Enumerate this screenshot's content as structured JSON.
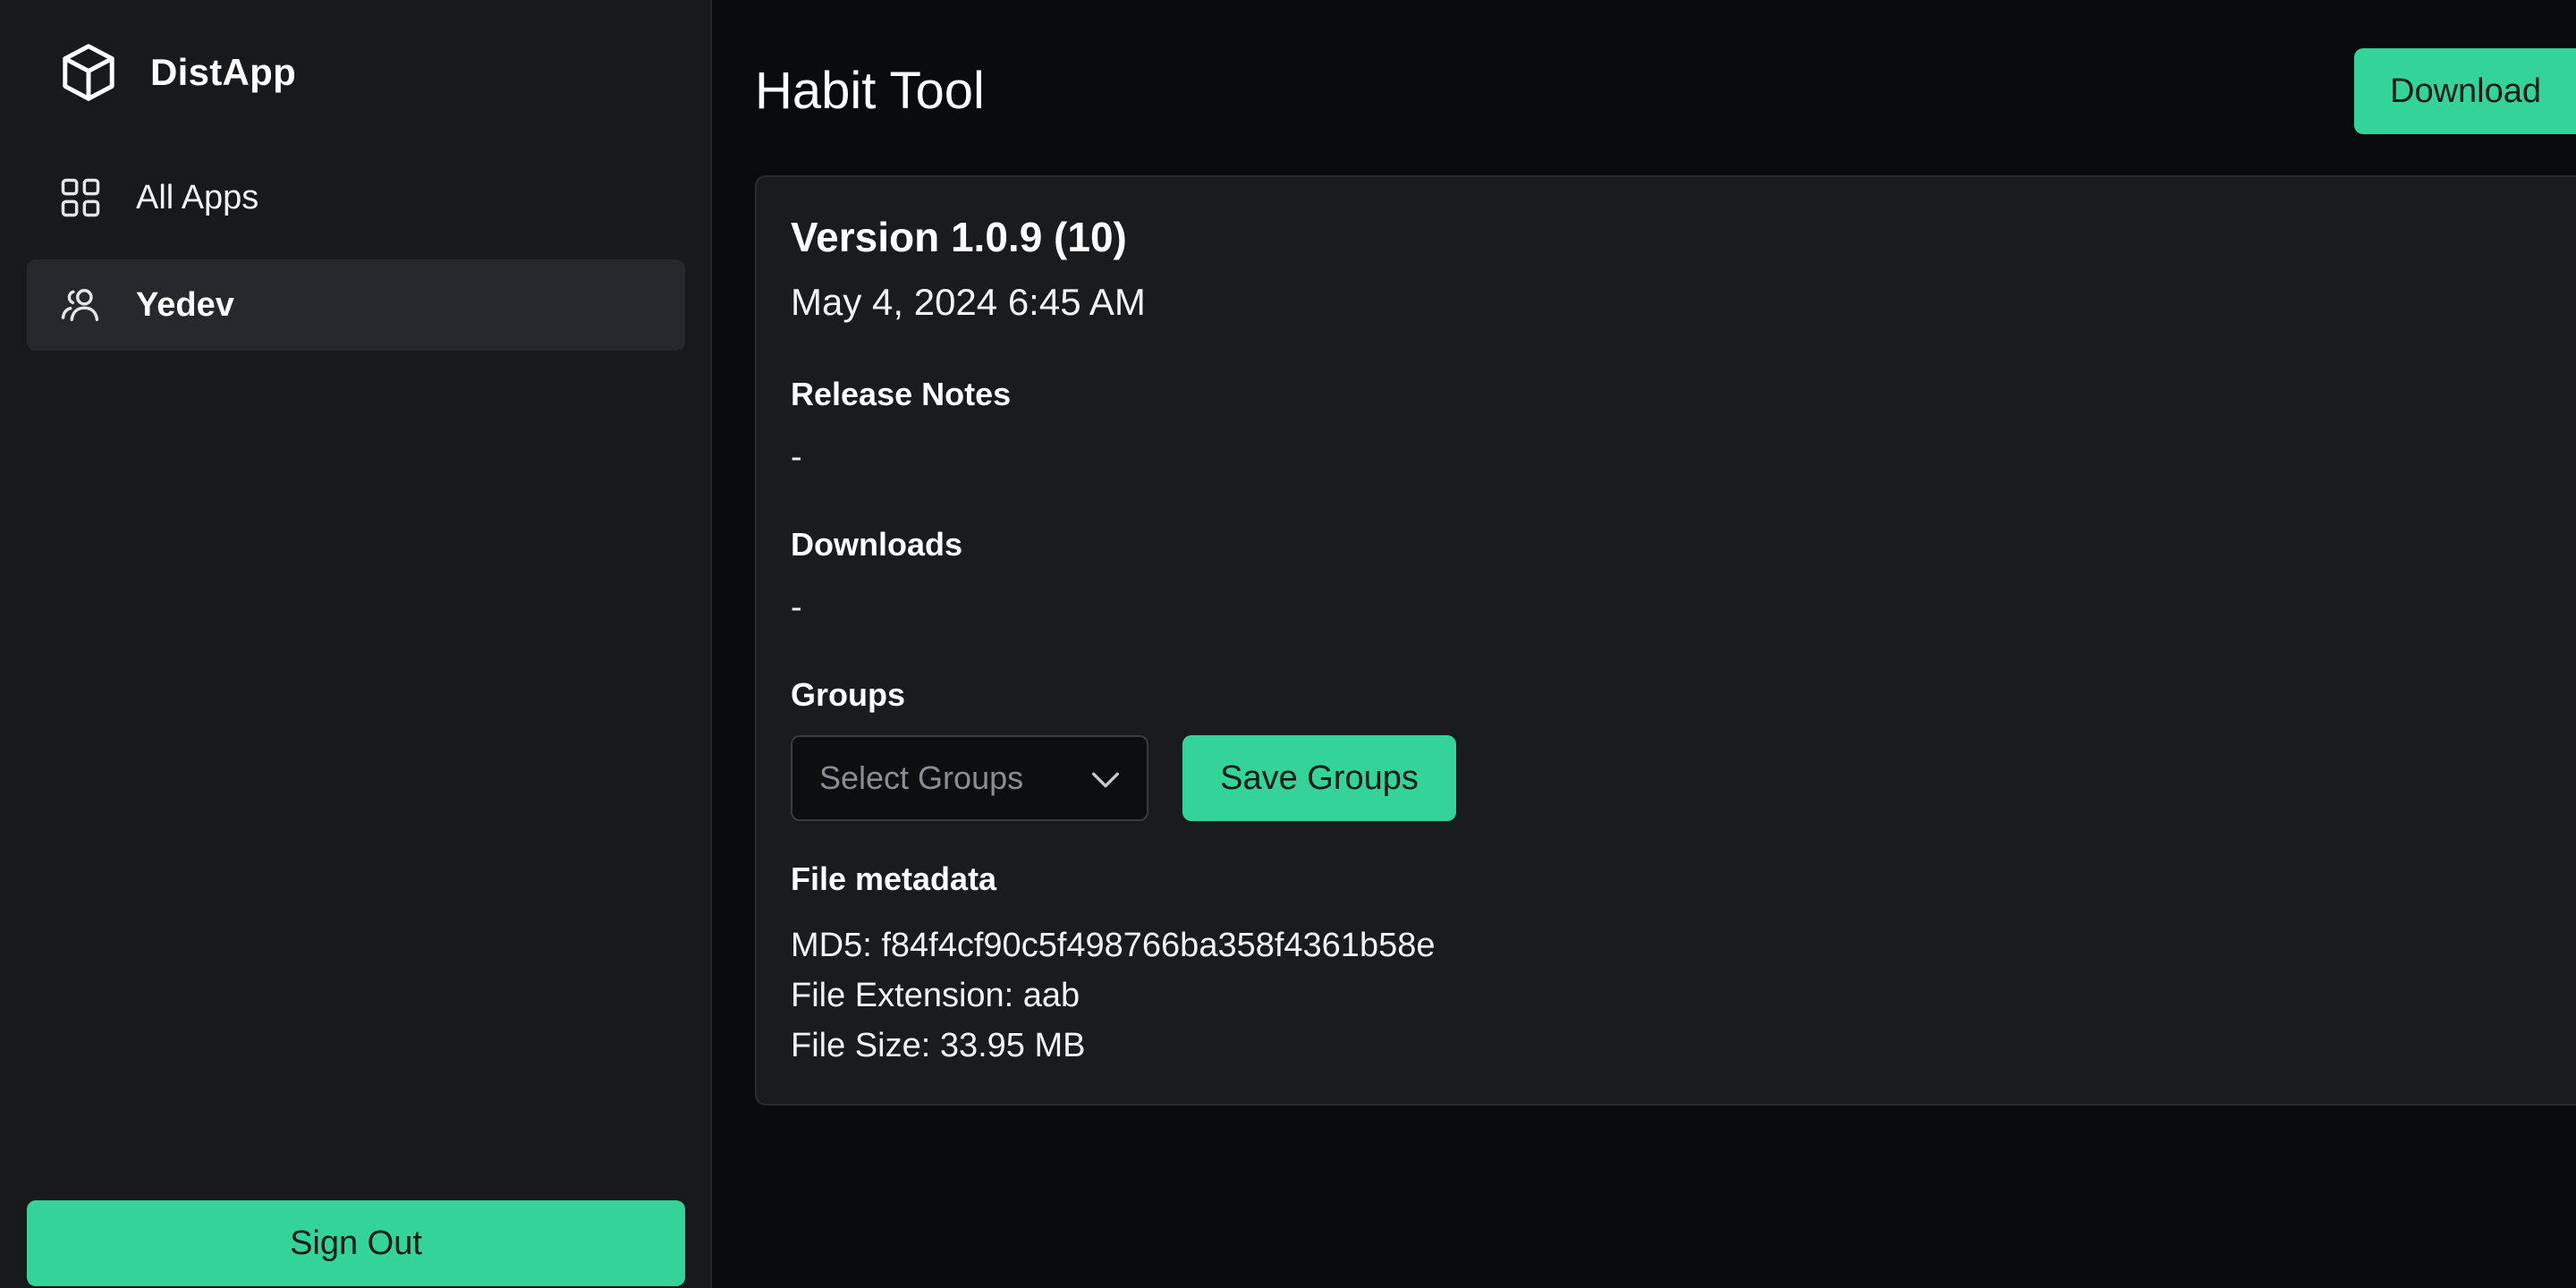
{
  "app": {
    "brand_name": "DistApp",
    "accent_color": "#34d399"
  },
  "sidebar": {
    "items": [
      {
        "label": "All Apps",
        "icon": "grid-icon",
        "active": false
      },
      {
        "label": "Yedev",
        "icon": "users-icon",
        "active": true
      }
    ],
    "sign_out_label": "Sign Out"
  },
  "header": {
    "title": "Habit Tool",
    "download_label": "Download"
  },
  "release": {
    "version": "Version 1.0.9 (10)",
    "date": "May 4, 2024 6:45 AM",
    "release_notes_label": "Release Notes",
    "release_notes_value": "-",
    "downloads_label": "Downloads",
    "downloads_value": "-",
    "groups_label": "Groups",
    "groups_placeholder": "Select Groups",
    "save_groups_label": "Save Groups",
    "file_metadata_label": "File metadata",
    "md5": "MD5: f84f4cf90c5f498766ba358f4361b58e",
    "file_extension": "File Extension: aab",
    "file_size": "File Size: 33.95 MB"
  }
}
